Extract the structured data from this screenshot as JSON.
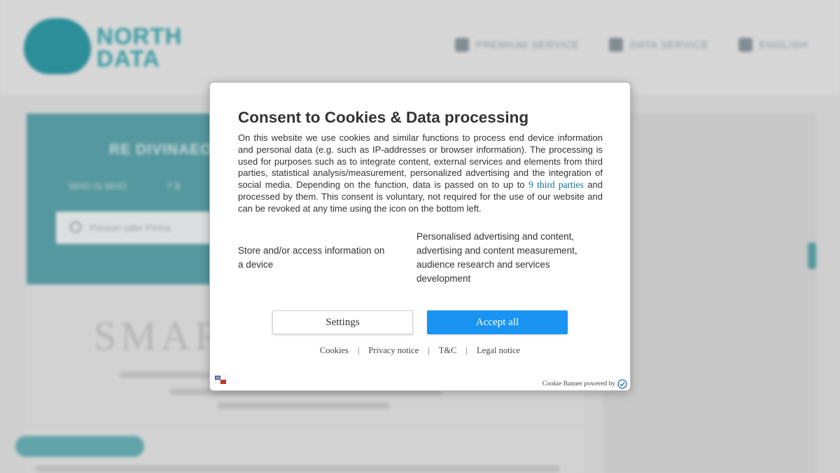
{
  "background": {
    "logo": {
      "line1": "NORTH",
      "line2": "DATA"
    },
    "nav": [
      {
        "label": "PREMIUM SERVICE",
        "icon": "star-icon"
      },
      {
        "label": "DATA SERVICE",
        "icon": "database-icon"
      },
      {
        "label": "ENGLISH",
        "icon": "flag-icon"
      }
    ],
    "hero": {
      "title": "RE DIVINAEO",
      "tabs": [
        "WHO IS WHO",
        "T B"
      ],
      "search_placeholder": "Person oder Firma"
    },
    "content": {
      "big_text": "SMAR"
    }
  },
  "dialog": {
    "title": "Consent to Cookies & Data processing",
    "body_before_link": "On this website we use cookies and similar functions to process end device information and personal data (e.g. such as IP-addresses or browser information). The processing is used for purposes such as to integrate content, external services and elements from third parties, statistical analysis/measurement, personalized advertising and the integration of social media. Depending on the function, data is passed on to up to",
    "third_parties_link": "9 third parties",
    "body_after_link": "and processed by them. This consent is voluntary, not required for the use of our website and can be revoked at any time using the icon on the bottom left.",
    "purposes": [
      "Store and/or access information on a device",
      "Personalised advertising and content, advertising and content measurement, audience research and services development"
    ],
    "settings_button": "Settings",
    "accept_button": "Accept all",
    "footer_links": [
      "Cookies",
      "Privacy notice",
      "T&C",
      "Legal notice"
    ],
    "separator": "|",
    "powered_by": "Cookie Banner powered by",
    "colors": {
      "accent": "#1a94f2",
      "link": "#0c6f8e",
      "brand": "#5aa6ae"
    }
  }
}
